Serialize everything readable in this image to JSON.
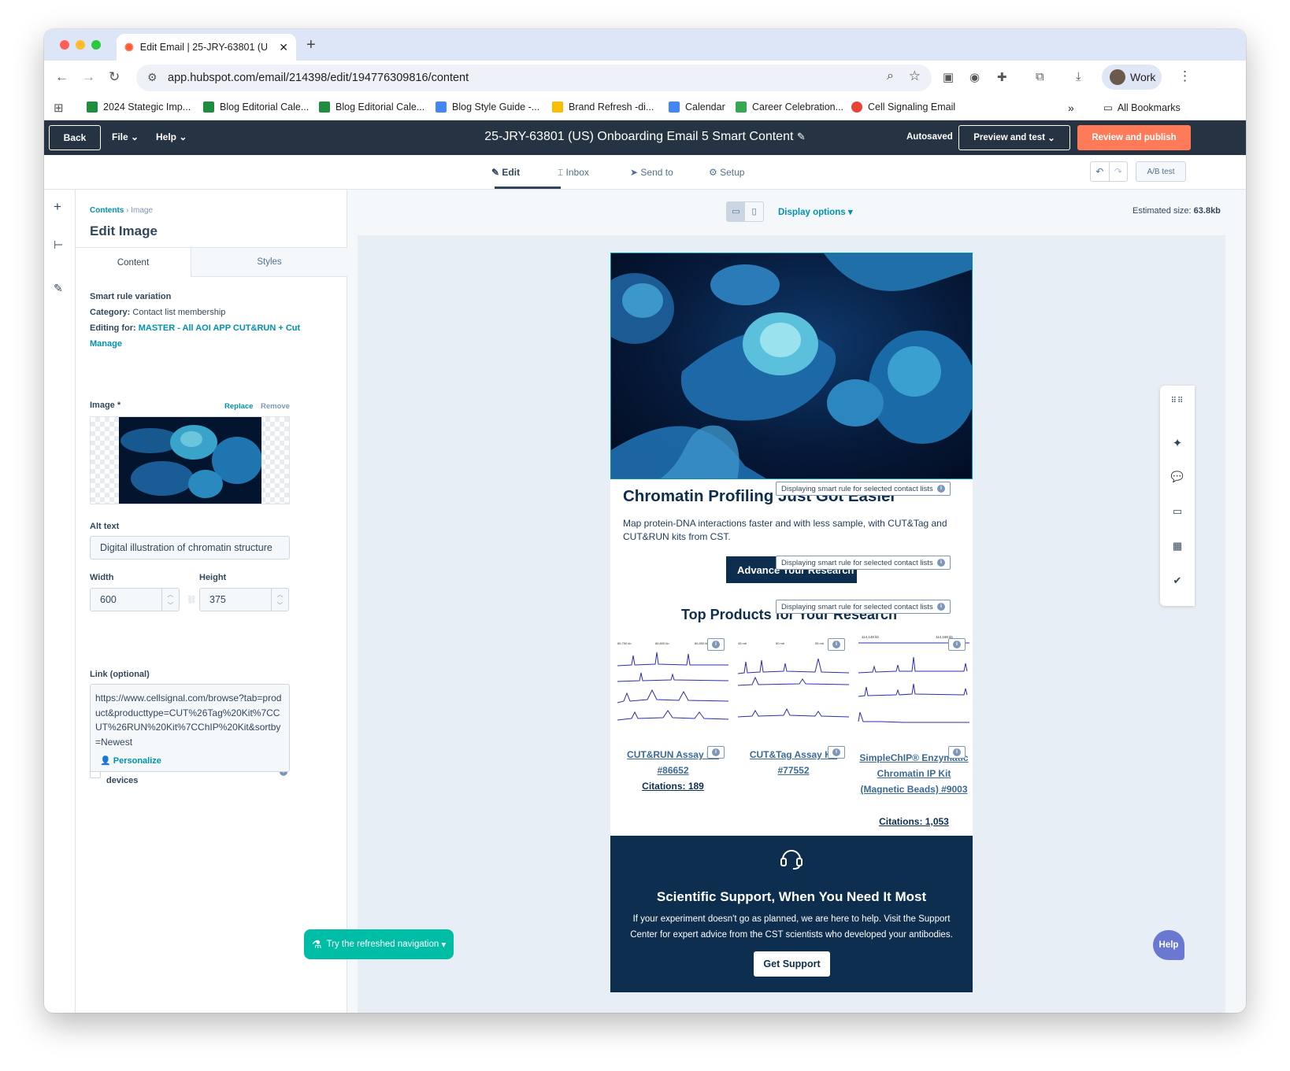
{
  "browser": {
    "tab_title": "Edit Email | 25-JRY-63801 (U",
    "url": "app.hubspot.com/email/214398/edit/194776309816/content",
    "profile": "Work",
    "bookmarks": [
      {
        "label": "2024 Stategic Imp...",
        "color": "#1e8e3e"
      },
      {
        "label": "Blog Editorial Cale...",
        "color": "#1e8e3e"
      },
      {
        "label": "Blog Editorial Cale...",
        "color": "#1e8e3e"
      },
      {
        "label": "Blog Style Guide -...",
        "color": "#4285f4"
      },
      {
        "label": "Brand Refresh -di...",
        "color": "#fbbc04"
      },
      {
        "label": "Calendar",
        "color": "#4285f4"
      },
      {
        "label": "Career Celebration...",
        "color": "#34a853"
      },
      {
        "label": "Cell Signaling Email",
        "color": "#ea4335"
      }
    ],
    "all_bookmarks": "All Bookmarks"
  },
  "header": {
    "back": "Back",
    "file": "File",
    "help": "Help",
    "title": "25-JRY-63801 (US) Onboarding Email 5 Smart Content",
    "autosaved": "Autosaved",
    "preview": "Preview and test",
    "publish": "Review and publish"
  },
  "subtabs": {
    "edit": "Edit",
    "inbox": "Inbox",
    "send_to": "Send to",
    "setup": "Setup",
    "ab_test": "A/B test"
  },
  "panel": {
    "crumb_root": "Contents",
    "crumb_leaf": "Image",
    "title": "Edit Image",
    "tab_content": "Content",
    "tab_styles": "Styles",
    "smart_rule": "Smart rule variation",
    "category_label": "Category:",
    "category_value": "Contact list membership",
    "editing_label": "Editing for:",
    "editing_value": "MASTER - All AOI APP CUT&RUN + Cut",
    "manage": "Manage",
    "image_label": "Image *",
    "replace": "Replace",
    "remove": "Remove",
    "alt_label": "Alt text",
    "alt_value": "Digital illustration of chromatin structure",
    "width_label": "Width",
    "width_value": "600",
    "height_label": "Height",
    "height_value": "375",
    "mobile_label": "Show as maximum width on mobile devices",
    "link_label": "Link (optional)",
    "link_value": "https://www.cellsignal.com/browse?tab=product&producttype=CUT%26Tag%20Kit%7CCUT%26RUN%20Kit%7CChIP%20Kit&sortby=Newest",
    "personalize": "Personalize"
  },
  "canvas": {
    "display_options": "Display options",
    "est_label": "Estimated size:",
    "est_value": "63.8kb",
    "smart_badge": "Displaying smart rule for selected contact lists",
    "hero_heading": "Chromatin Profiling Just Got Easier",
    "hero_text": "Map protein-DNA interactions faster and with less sample, with CUT&Tag and CUT&RUN kits from CST.",
    "cta": "Advance Your Research",
    "products_heading": "Top Products for Your Research",
    "products": [
      {
        "name": "CUT&RUN Assay Kit #86652",
        "citations": "Citations: 189"
      },
      {
        "name": "CUT&Tag Assay Kit #77552",
        "citations": ""
      },
      {
        "name": "SimpleChIP® Enzymatic Chromatin IP Kit (Magnetic Beads) #9003",
        "citations": "Citations: 1,053"
      }
    ],
    "support_heading": "Scientific Support, When You Need It Most",
    "support_text": "If your experiment doesn't go as planned, we are here to help. Visit the Support Center for expert advice from the CST scientists who developed your antibodies.",
    "support_btn": "Get Support"
  },
  "floating": {
    "try_nav": "Try the refreshed navigation",
    "help": "Help"
  }
}
